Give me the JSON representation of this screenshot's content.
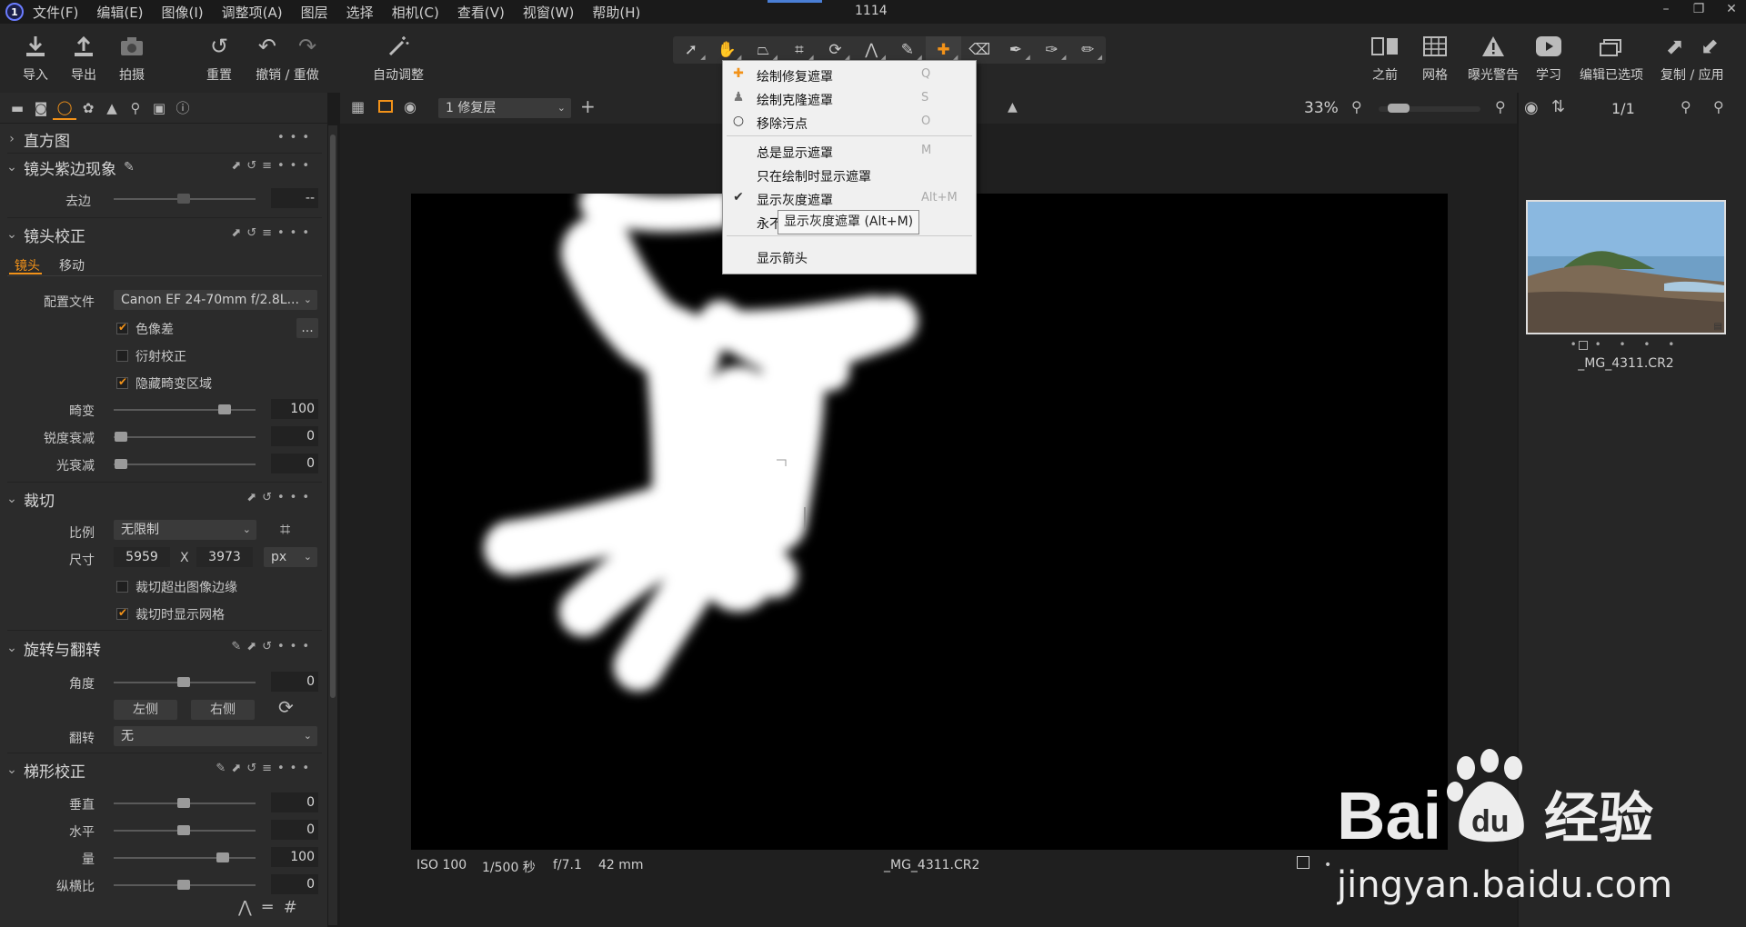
{
  "menubar": {
    "items": [
      "文件(F)",
      "编辑(E)",
      "图像(I)",
      "调整项(A)",
      "图层",
      "选择",
      "相机(C)",
      "查看(V)",
      "视窗(W)",
      "帮助(H)"
    ],
    "title": "1114"
  },
  "toolbar": {
    "left_buttons": [
      {
        "label": "导入",
        "icon": "import-icon"
      },
      {
        "label": "导出",
        "icon": "export-icon"
      },
      {
        "label": "拍摄",
        "icon": "camera-icon"
      }
    ],
    "reset_label": "重置",
    "undo_redo_label": "撤销 / 重做",
    "auto_label": "自动调整",
    "right_buttons": [
      {
        "label": "之前",
        "icon": "before-after-icon"
      },
      {
        "label": "网格",
        "icon": "grid-icon"
      },
      {
        "label": "曝光警告",
        "icon": "warning-icon"
      },
      {
        "label": "学习",
        "icon": "play-icon"
      },
      {
        "label": "编辑已选项",
        "icon": "edit-selected-icon"
      },
      {
        "label": "复制 / 应用",
        "icon": "copy-apply-icon"
      }
    ]
  },
  "left_panel": {
    "histogram_title": "直方图",
    "fringing": {
      "title": "镜头紫边现象",
      "defringe_label": "去边",
      "defringe_value": "--"
    },
    "lens": {
      "title": "镜头校正",
      "tab_lens": "镜头",
      "tab_move": "移动",
      "profile_label": "配置文件",
      "profile_value": "Canon EF 24-70mm f/2.8L...",
      "more_btn": "...",
      "chromatic_label": "色像差",
      "diffraction_label": "衍射校正",
      "hide_distortion_label": "隐藏畸变区域",
      "distortion_label": "畸变",
      "distortion_value": "100",
      "sharpness_label": "锐度衰减",
      "sharpness_value": "0",
      "light_label": "光衰减",
      "light_value": "0"
    },
    "crop": {
      "title": "裁切",
      "ratio_label": "比例",
      "ratio_value": "无限制",
      "size_label": "尺寸",
      "width": "5959",
      "x_sep": "X",
      "height": "3973",
      "unit": "px",
      "outside_label": "裁切超出图像边缘",
      "grid_label": "裁切时显示网格"
    },
    "rotate": {
      "title": "旋转与翻转",
      "angle_label": "角度",
      "angle_value": "0",
      "left_btn": "左侧",
      "right_btn": "右侧",
      "flip_label": "翻转",
      "flip_value": "无"
    },
    "keystone": {
      "title": "梯形校正",
      "vertical_label": "垂直",
      "vertical_value": "0",
      "horizontal_label": "水平",
      "horizontal_value": "0",
      "amount_label": "量",
      "amount_value": "100",
      "aspect_label": "纵横比",
      "aspect_value": "0"
    }
  },
  "viewer": {
    "layer": "1 修复层",
    "zoom": "33%",
    "info": {
      "iso": "ISO 100",
      "shutter": "1/500 秒",
      "aperture": "f/7.1",
      "focal": "42 mm",
      "filename": "_MG_4311.CR2"
    }
  },
  "right_panel": {
    "count": "1/1",
    "thumb_name": "_MG_4311.CR2",
    "thumb_dots": "• • • • •"
  },
  "context_menu": {
    "items": [
      {
        "label": "绘制修复遮罩",
        "key": "Q",
        "icon": "heal-brush-icon"
      },
      {
        "label": "绘制克隆遮罩",
        "key": "S",
        "icon": "clone-stamp-icon"
      },
      {
        "label": "移除污点",
        "key": "O",
        "icon": "spot-circle-icon"
      },
      {
        "label": "总是显示遮罩",
        "key": "M"
      },
      {
        "label": "只在绘制时显示遮罩",
        "key": ""
      },
      {
        "label": "显示灰度遮罩",
        "key": "Alt+M"
      },
      {
        "label": "永不",
        "key": ""
      },
      {
        "label": "显示箭头",
        "key": ""
      }
    ],
    "tooltip": "显示灰度遮罩 (Alt+M)"
  },
  "watermark": {
    "brand": "Bai",
    "brand2": "经验",
    "du": "du",
    "url": "jingyan.baidu.com"
  },
  "colors": {
    "accent": "#f29219",
    "bg": "#1c1c1c",
    "panel": "#2b2b2b"
  }
}
